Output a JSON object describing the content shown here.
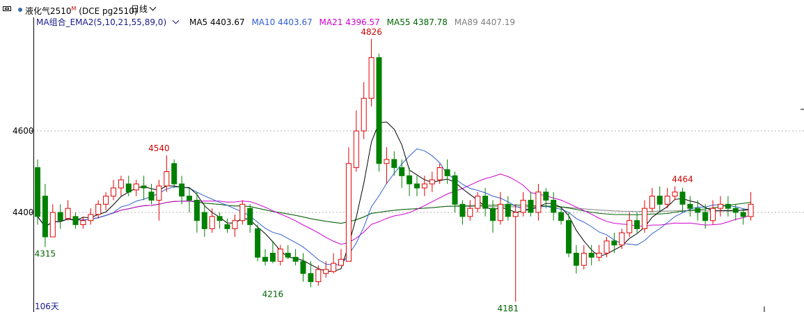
{
  "toolbar": {
    "symbol": "液化气2510",
    "symbol_mark": "M",
    "contract": "(DCE pg2510)",
    "period": "日线"
  },
  "legend": {
    "indicator": "MA组合_EMA2(5,10,21,55,89,0)",
    "ma5": "MA5 4403.67",
    "ma10": "MA10 4403.67",
    "ma21": "MA21 4396.57",
    "ma55": "MA55 4387.78",
    "ma89": "MA89 4407.19"
  },
  "colors": {
    "up": "#e00000",
    "down": "#008000",
    "ma5": "#000000",
    "ma10": "#3060d0",
    "ma21": "#d000d0",
    "ma55": "#006400",
    "ma89": "#808080",
    "label_high": "#d00000",
    "label_low": "#006400"
  },
  "chart_data": {
    "type": "candlestick",
    "ylim": [
      4165,
      4890
    ],
    "y_ticks": [
      "4600",
      "4400"
    ],
    "days_label": "106天",
    "annotations": [
      {
        "text": "4826",
        "value": 4826,
        "index": 44,
        "kind": "high"
      },
      {
        "text": "4540",
        "value": 4540,
        "index": 16,
        "kind": "high"
      },
      {
        "text": "4464",
        "value": 4464,
        "index": 85,
        "kind": "high"
      },
      {
        "text": "4315",
        "value": 4315,
        "index": 1,
        "kind": "low"
      },
      {
        "text": "4216",
        "value": 4216,
        "index": 31,
        "kind": "low"
      },
      {
        "text": "4181",
        "value": 4181,
        "index": 62,
        "kind": "low"
      }
    ],
    "candles": [
      [
        4510,
        4390,
        4530,
        4370
      ],
      [
        4440,
        4340,
        4470,
        4315
      ],
      [
        4340,
        4400,
        4420,
        4340
      ],
      [
        4400,
        4380,
        4420,
        4360
      ],
      [
        4385,
        4410,
        4430,
        4380
      ],
      [
        4390,
        4370,
        4400,
        4360
      ],
      [
        4370,
        4380,
        4390,
        4360
      ],
      [
        4380,
        4395,
        4410,
        4370
      ],
      [
        4395,
        4420,
        4430,
        4385
      ],
      [
        4420,
        4440,
        4450,
        4405
      ],
      [
        4440,
        4460,
        4480,
        4430
      ],
      [
        4460,
        4480,
        4490,
        4440
      ],
      [
        4470,
        4450,
        4490,
        4440
      ],
      [
        4455,
        4470,
        4480,
        4440
      ],
      [
        4465,
        4460,
        4490,
        4430
      ],
      [
        4450,
        4430,
        4470,
        4420
      ],
      [
        4430,
        4465,
        4480,
        4380
      ],
      [
        4465,
        4500,
        4540,
        4450
      ],
      [
        4520,
        4470,
        4530,
        4460
      ],
      [
        4470,
        4440,
        4490,
        4420
      ],
      [
        4440,
        4430,
        4460,
        4400
      ],
      [
        4430,
        4380,
        4450,
        4350
      ],
      [
        4400,
        4360,
        4420,
        4340
      ],
      [
        4360,
        4390,
        4410,
        4350
      ],
      [
        4390,
        4380,
        4400,
        4360
      ],
      [
        4370,
        4360,
        4385,
        4350
      ],
      [
        4360,
        4380,
        4395,
        4340
      ],
      [
        4380,
        4420,
        4430,
        4370
      ],
      [
        4410,
        4370,
        4420,
        4350
      ],
      [
        4360,
        4290,
        4370,
        4280
      ],
      [
        4290,
        4280,
        4310,
        4270
      ],
      [
        4300,
        4280,
        4330,
        4275
      ],
      [
        4280,
        4310,
        4320,
        4270
      ],
      [
        4300,
        4290,
        4320,
        4285
      ],
      [
        4290,
        4280,
        4310,
        4270
      ],
      [
        4280,
        4250,
        4300,
        4230
      ],
      [
        4250,
        4230,
        4280,
        4216
      ],
      [
        4230,
        4260,
        4270,
        4220
      ],
      [
        4250,
        4260,
        4280,
        4240
      ],
      [
        4255,
        4275,
        4300,
        4250
      ],
      [
        4270,
        4285,
        4310,
        4270
      ],
      [
        4280,
        4520,
        4560,
        4280
      ],
      [
        4510,
        4600,
        4650,
        4500
      ],
      [
        4600,
        4680,
        4720,
        4580
      ],
      [
        4680,
        4780,
        4826,
        4660
      ],
      [
        4780,
        4520,
        4790,
        4500
      ],
      [
        4520,
        4530,
        4560,
        4470
      ],
      [
        4530,
        4510,
        4550,
        4490
      ],
      [
        4510,
        4490,
        4530,
        4460
      ],
      [
        4490,
        4470,
        4510,
        4440
      ],
      [
        4470,
        4460,
        4490,
        4440
      ],
      [
        4460,
        4470,
        4490,
        4440
      ],
      [
        4470,
        4480,
        4500,
        4450
      ],
      [
        4480,
        4510,
        4520,
        4470
      ],
      [
        4505,
        4490,
        4530,
        4470
      ],
      [
        4490,
        4420,
        4500,
        4400
      ],
      [
        4420,
        4390,
        4430,
        4370
      ],
      [
        4390,
        4410,
        4430,
        4380
      ],
      [
        4410,
        4440,
        4450,
        4400
      ],
      [
        4440,
        4410,
        4460,
        4390
      ],
      [
        4410,
        4380,
        4430,
        4350
      ],
      [
        4380,
        4420,
        4450,
        4370
      ],
      [
        4420,
        4390,
        4440,
        4380
      ],
      [
        4390,
        4400,
        4420,
        4181
      ],
      [
        4400,
        4430,
        4450,
        4390
      ],
      [
        4430,
        4400,
        4450,
        4390
      ],
      [
        4400,
        4450,
        4470,
        4380
      ],
      [
        4450,
        4430,
        4460,
        4410
      ],
      [
        4430,
        4400,
        4450,
        4380
      ],
      [
        4400,
        4380,
        4410,
        4370
      ],
      [
        4380,
        4300,
        4400,
        4290
      ],
      [
        4300,
        4270,
        4320,
        4250
      ],
      [
        4270,
        4300,
        4320,
        4260
      ],
      [
        4300,
        4290,
        4320,
        4270
      ],
      [
        4290,
        4300,
        4320,
        4280
      ],
      [
        4300,
        4330,
        4340,
        4290
      ],
      [
        4330,
        4320,
        4350,
        4300
      ],
      [
        4320,
        4350,
        4360,
        4310
      ],
      [
        4350,
        4380,
        4400,
        4340
      ],
      [
        4380,
        4360,
        4400,
        4350
      ],
      [
        4360,
        4410,
        4430,
        4350
      ],
      [
        4410,
        4440,
        4460,
        4400
      ],
      [
        4440,
        4420,
        4464,
        4400
      ],
      [
        4420,
        4440,
        4460,
        4410
      ],
      [
        4440,
        4450,
        4464,
        4430
      ],
      [
        4450,
        4420,
        4460,
        4400
      ],
      [
        4420,
        4410,
        4440,
        4390
      ],
      [
        4410,
        4400,
        4430,
        4380
      ],
      [
        4400,
        4380,
        4420,
        4360
      ],
      [
        4380,
        4410,
        4430,
        4370
      ],
      [
        4410,
        4420,
        4440,
        4390
      ],
      [
        4420,
        4410,
        4440,
        4390
      ],
      [
        4410,
        4400,
        4420,
        4380
      ],
      [
        4400,
        4390,
        4410,
        4370
      ],
      [
        4390,
        4420,
        4450,
        4380
      ]
    ]
  }
}
